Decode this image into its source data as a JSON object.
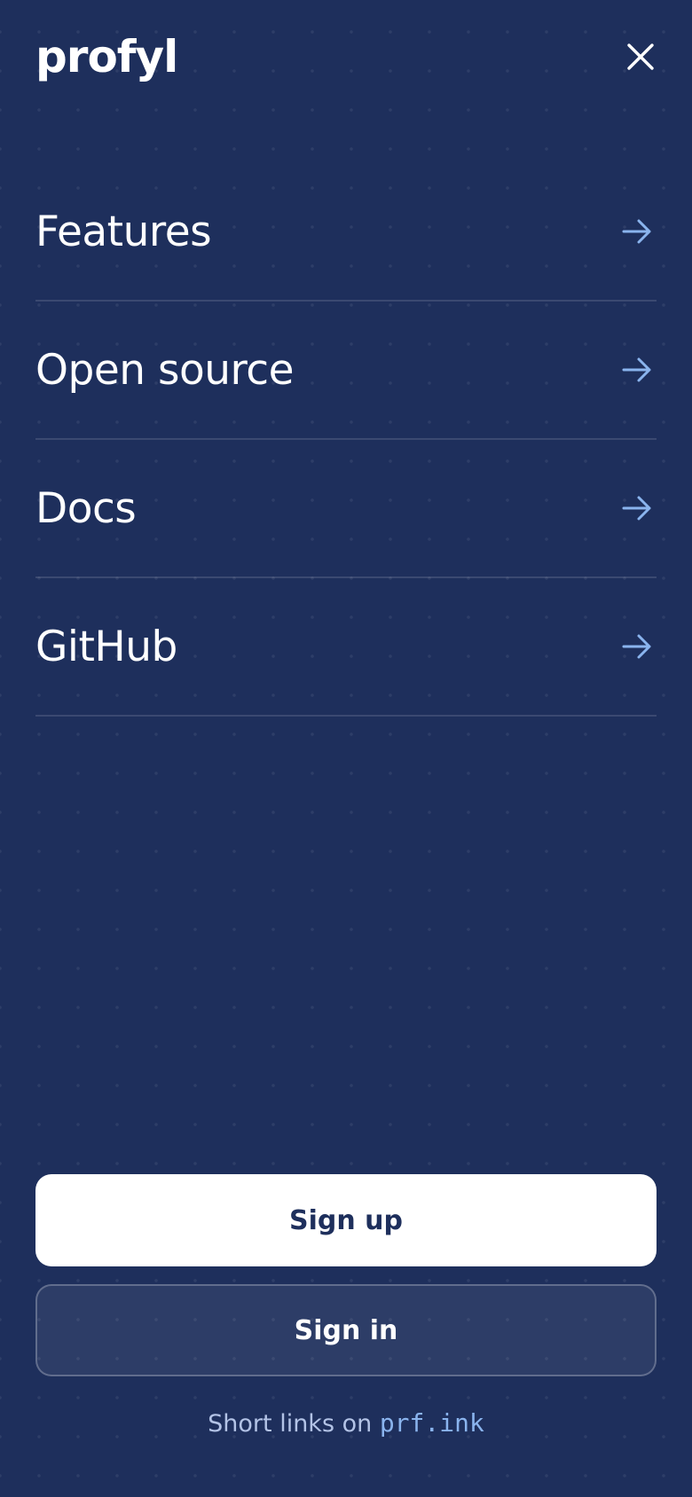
{
  "app": {
    "logo_text": "profyl"
  },
  "colors": {
    "background": "#1e2f5c",
    "accent": "#8ab4ee",
    "text": "#ffffff"
  },
  "nav": {
    "items": [
      {
        "label": "Features",
        "icon": "arrow-right-icon"
      },
      {
        "label": "Open source",
        "icon": "arrow-right-icon"
      },
      {
        "label": "Docs",
        "icon": "arrow-right-icon"
      },
      {
        "label": "GitHub",
        "icon": "arrow-right-icon"
      }
    ]
  },
  "actions": {
    "sign_up_label": "Sign up",
    "sign_in_label": "Sign in"
  },
  "footer": {
    "prefix": "Short links on",
    "domain": "prf.ink"
  },
  "icons": {
    "close": "close-icon",
    "arrow": "arrow-right-icon"
  }
}
